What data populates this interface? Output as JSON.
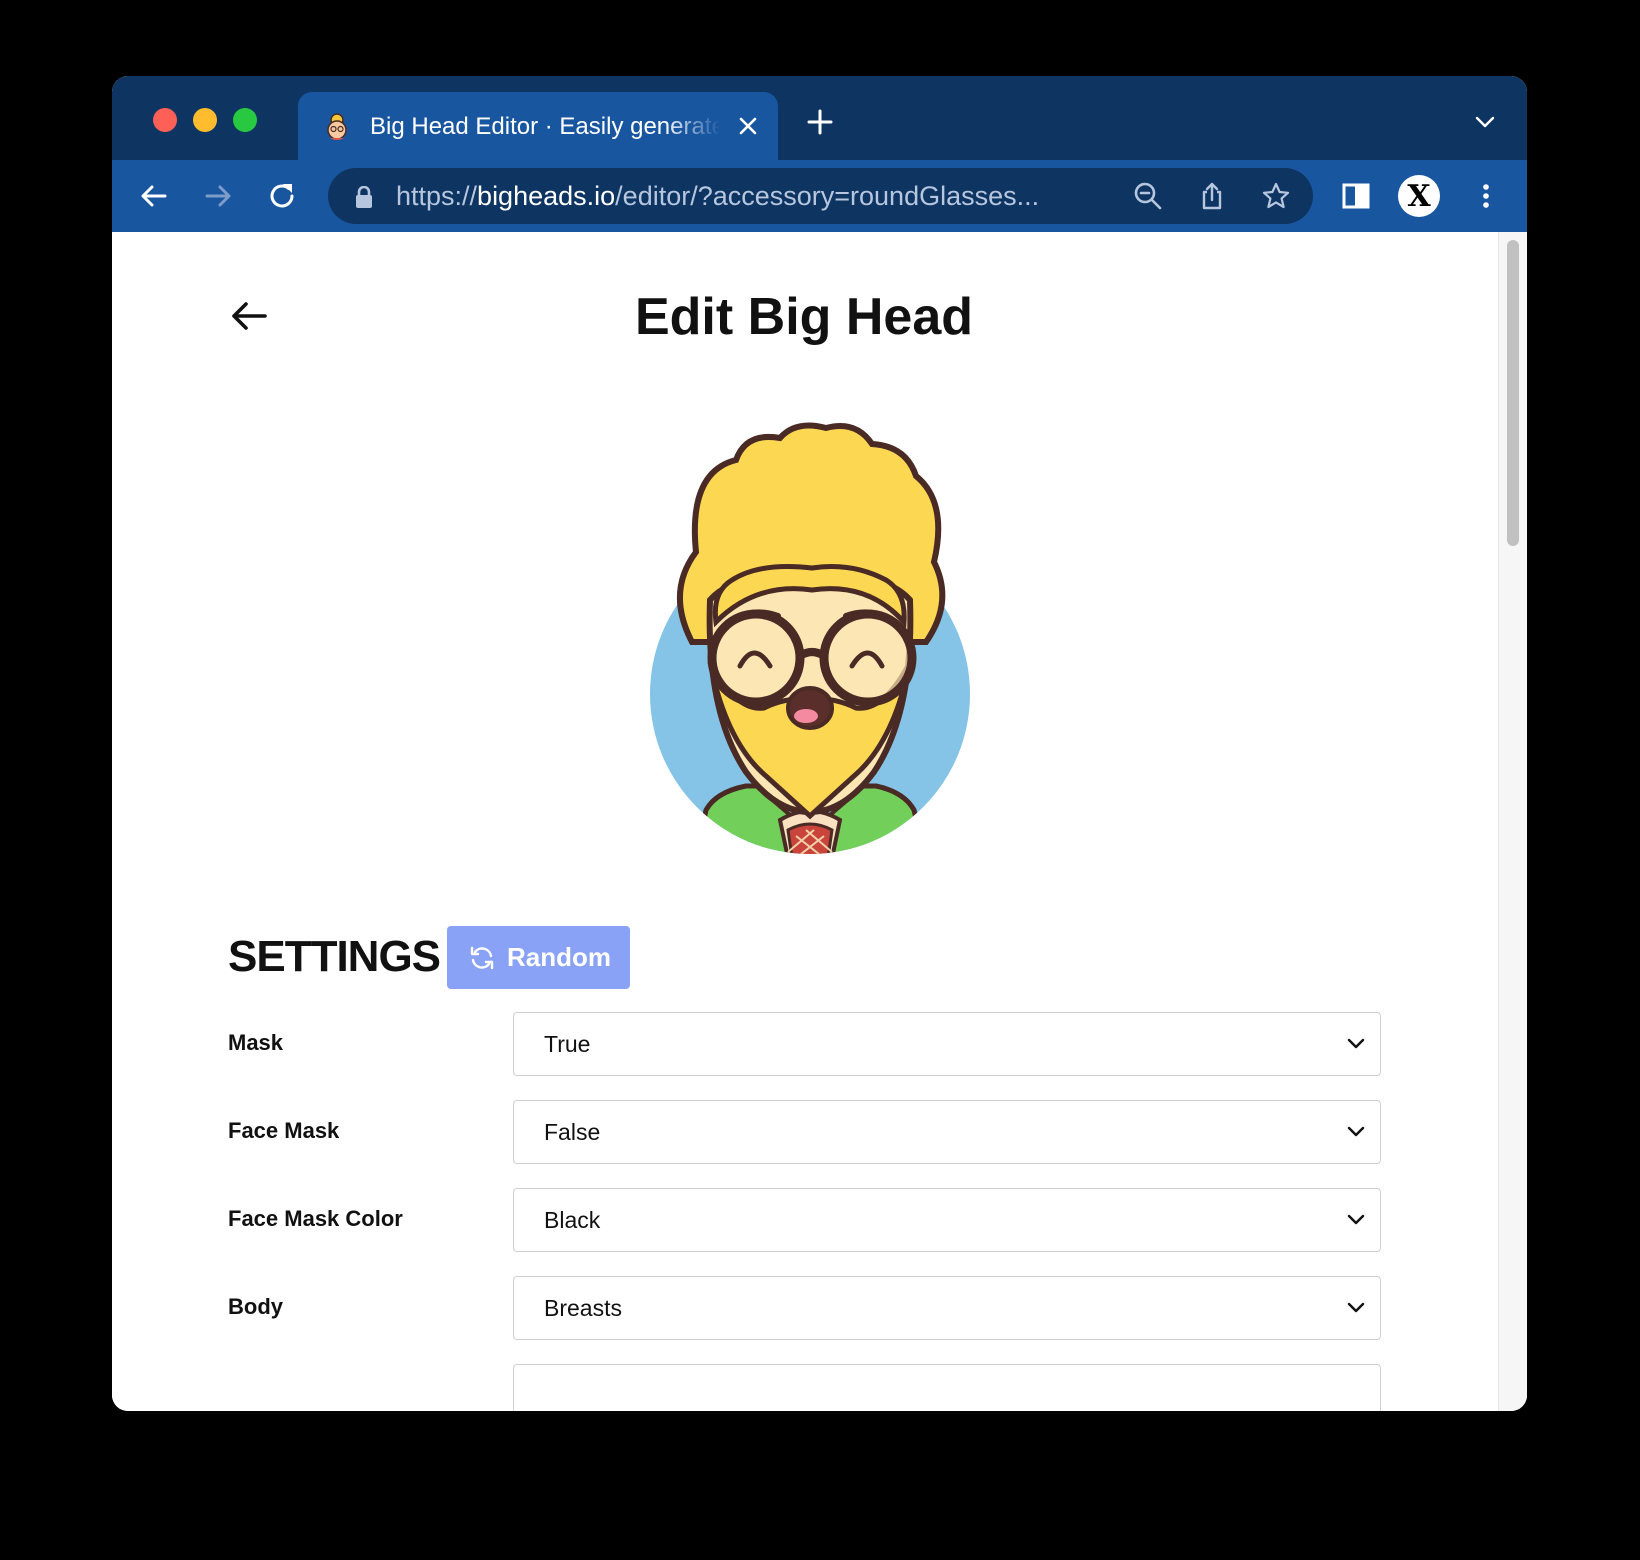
{
  "browser": {
    "tab_title": "Big Head Editor · Easily generate",
    "url_scheme": "https://",
    "url_host": "bigheads.io",
    "url_path": "/editor/?accessory=roundGlasses...",
    "profile_initial": "X"
  },
  "page": {
    "title": "Edit Big Head"
  },
  "settings": {
    "title": "SETTINGS",
    "random_label": "Random",
    "rows": [
      {
        "label": "Mask",
        "value": "True"
      },
      {
        "label": "Face Mask",
        "value": "False"
      },
      {
        "label": "Face Mask Color",
        "value": "Black"
      },
      {
        "label": "Body",
        "value": "Breasts"
      },
      {
        "label": "",
        "value": ""
      }
    ]
  },
  "colors": {
    "tabstrip": "#0e3462",
    "toolbar": "#1956a0",
    "random_button": "#8aa2f5",
    "avatar_hair": "#fcd852",
    "avatar_background": "#85c4e6",
    "avatar_shirt": "#72d05a"
  },
  "icons": [
    "back-arrow-icon",
    "forward-arrow-icon",
    "reload-icon",
    "lock-icon",
    "zoom-icon",
    "share-icon",
    "star-icon",
    "sidebar-icon",
    "more-icon",
    "close-icon",
    "plus-icon",
    "chevron-down-icon",
    "refresh-icon"
  ]
}
